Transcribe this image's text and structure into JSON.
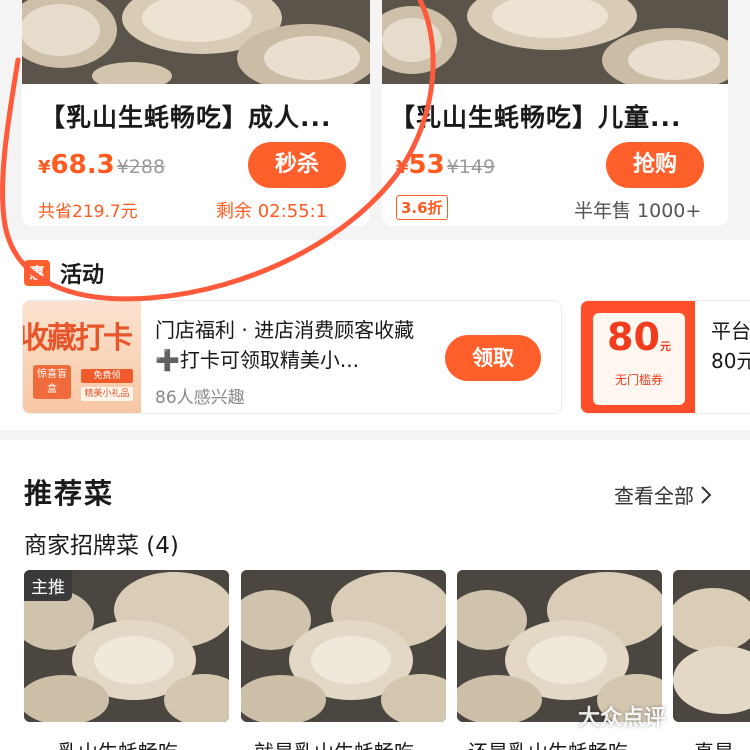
{
  "deals": [
    {
      "title": "【乳山生蚝畅吃】成人...",
      "currency": "¥",
      "price": "68.3",
      "original_price": "¥288",
      "button": "秒杀",
      "savings": "共省219.7元",
      "countdown": "剩余 02:55:1"
    },
    {
      "title": "【乳山生蚝畅吃】儿童...",
      "currency": "¥",
      "price": "53",
      "original_price": "¥149",
      "button": "抢购",
      "discount": "3.6折",
      "sold": "半年售 1000+"
    }
  ],
  "activity": {
    "badge": "惠",
    "title": "活动",
    "promo": {
      "thumb_big": "收藏打卡",
      "thumb_box": "惊喜盲盒",
      "thumb_tag1": "免费领",
      "thumb_tag2": "精美小礼品",
      "text": "门店福利 · 进店消费顾客收藏➕打卡可领取精美小...",
      "meta": "86人感兴趣",
      "button": "领取"
    },
    "coupon": {
      "amount": "80",
      "unit": "元",
      "label": "无门槛券",
      "title": "平台",
      "sub": "80元"
    }
  },
  "recommended": {
    "title": "推荐菜",
    "view_all": "查看全部",
    "subtitle": "商家招牌菜 (4)",
    "main_tag": "主推",
    "dishes": [
      "乳山生蚝畅吃",
      "就是乳山生蚝畅吃",
      "还是乳山生蚝畅吃",
      "真是"
    ]
  },
  "watermark": "大众点评",
  "colors": {
    "accent": "#ff5f2a",
    "price": "#ff5a1f",
    "annotation": "#ff5a3c"
  }
}
